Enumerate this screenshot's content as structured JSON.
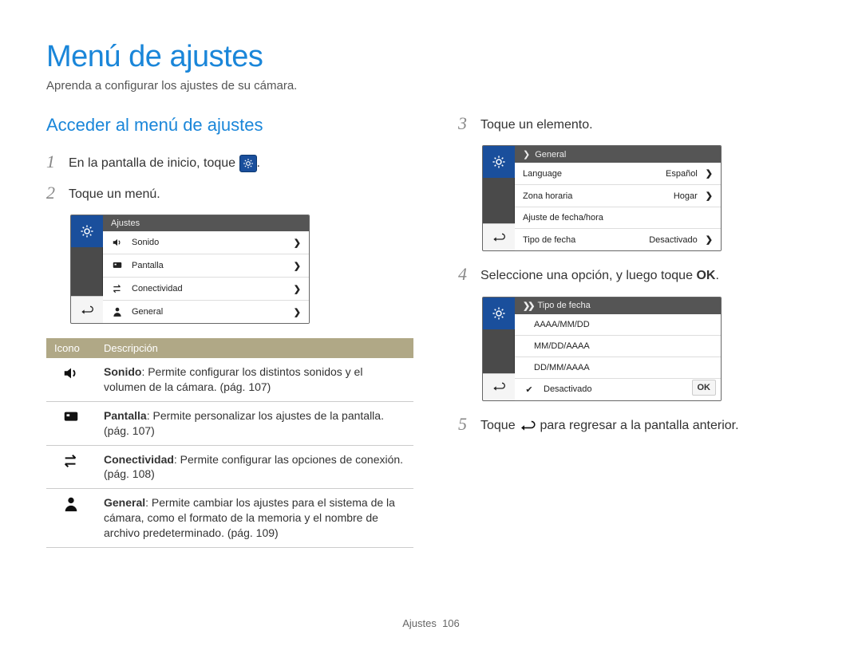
{
  "title": "Menú de ajustes",
  "subtitle": "Aprenda a configurar los ajustes de su cámara.",
  "section": "Acceder al menú de ajustes",
  "steps": {
    "s1": "En la pantalla de inicio, toque",
    "s1_after": ".",
    "s2": "Toque un menú.",
    "s3": "Toque un elemento.",
    "s4_before": "Seleccione una opción, y luego toque",
    "s4_after": ".",
    "s5_before": "Toque",
    "s5_after": "para regresar a la pantalla anterior."
  },
  "screen1": {
    "header": "Ajustes",
    "items": [
      {
        "label": "Sonido"
      },
      {
        "label": "Pantalla"
      },
      {
        "label": "Conectividad"
      },
      {
        "label": "General"
      }
    ]
  },
  "screen2": {
    "header": "General",
    "items": [
      {
        "label": "Language",
        "value": "Español",
        "chev": true
      },
      {
        "label": "Zona horaria",
        "value": "Hogar",
        "chev": true
      },
      {
        "label": "Ajuste de fecha/hora",
        "value": "",
        "chev": false
      },
      {
        "label": "Tipo de fecha",
        "value": "Desactivado",
        "chev": true
      }
    ]
  },
  "screen3": {
    "header": "Tipo de fecha",
    "items": [
      {
        "label": "AAAA/MM/DD"
      },
      {
        "label": "MM/DD/AAAA"
      },
      {
        "label": "DD/MM/AAAA"
      },
      {
        "label": "Desactivado",
        "checked": true
      }
    ],
    "ok": "OK"
  },
  "table": {
    "col0": "Icono",
    "col1": "Descripción",
    "rows": [
      {
        "title": "Sonido",
        "desc": ": Permite configurar los distintos sonidos y el volumen de la cámara. (pág. 107)"
      },
      {
        "title": "Pantalla",
        "desc": ": Permite personalizar los ajustes de la pantalla. (pág. 107)"
      },
      {
        "title": "Conectividad",
        "desc": ": Permite configurar las opciones de conexión. (pág. 108)"
      },
      {
        "title": "General",
        "desc": ": Permite cambiar los ajustes para el sistema de la cámara, como el formato de la memoria y el nombre de archivo predeterminado. (pág. 109)"
      }
    ]
  },
  "ok_inline": "OK",
  "footer_label": "Ajustes",
  "footer_page": "106"
}
